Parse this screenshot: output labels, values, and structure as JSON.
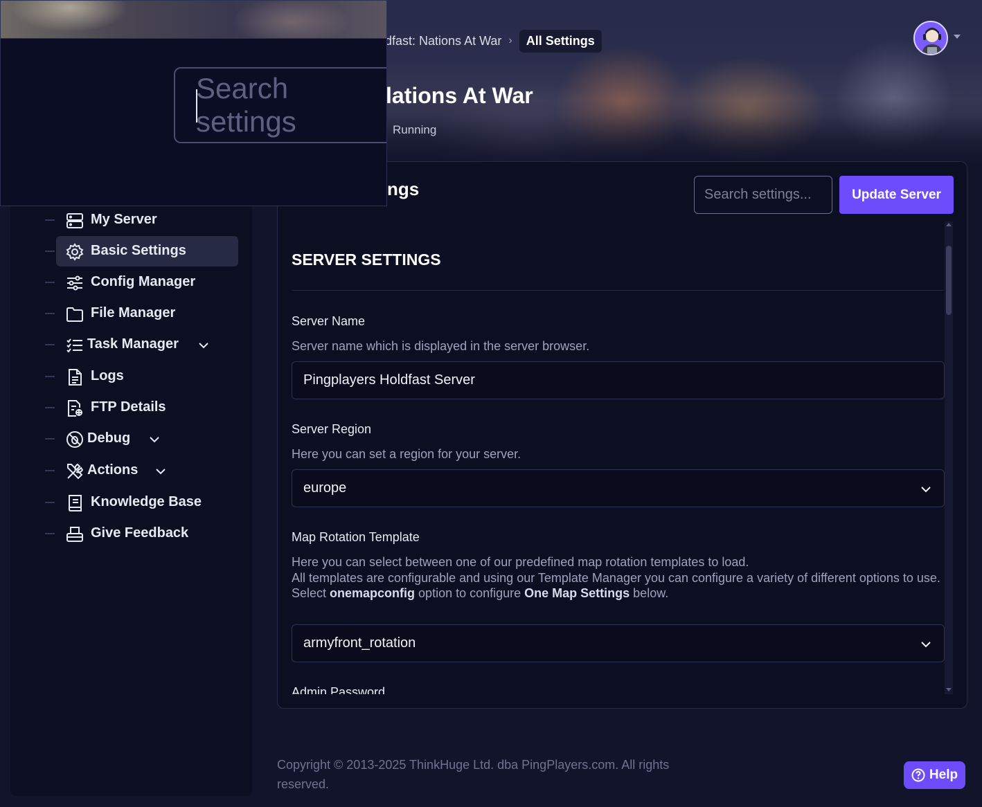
{
  "breadcrumb": {
    "game": "dfast: Nations At War",
    "current": "All Settings"
  },
  "header": {
    "title": "lations At War",
    "status": "Running"
  },
  "sidebar": {
    "items": [
      {
        "label": "My Server",
        "icon": "server-icon"
      },
      {
        "label": "Basic Settings",
        "icon": "gear-icon",
        "active": true
      },
      {
        "label": "Config Manager",
        "icon": "sliders-icon"
      },
      {
        "label": "File Manager",
        "icon": "folder-icon"
      },
      {
        "label": "Task Manager",
        "icon": "task-list-icon",
        "expandable": true
      },
      {
        "label": "Logs",
        "icon": "document-icon"
      },
      {
        "label": "FTP Details",
        "icon": "ftp-file-icon"
      },
      {
        "label": "Debug",
        "icon": "bug-icon",
        "expandable": true
      },
      {
        "label": "Actions",
        "icon": "tools-icon",
        "expandable": true
      },
      {
        "label": "Knowledge Base",
        "icon": "book-icon"
      },
      {
        "label": "Give Feedback",
        "icon": "feedback-icon"
      }
    ]
  },
  "card": {
    "title": "ngs",
    "search_placeholder": "Search settings...",
    "update_button": "Update Server"
  },
  "settings": {
    "section_title": "SERVER SETTINGS",
    "server_name": {
      "label": "Server Name",
      "description": "Server name which is displayed in the server browser.",
      "value": "Pingplayers Holdfast Server"
    },
    "server_region": {
      "label": "Server Region",
      "description": "Here you can set a region for your server.",
      "value": "europe"
    },
    "map_rotation": {
      "label": "Map Rotation Template",
      "desc_line1": "Here you can select between one of our predefined map rotation templates to load.",
      "desc_line2": "All templates are configurable and using our Template Manager you can configure a variety of different options to use.",
      "desc_line3_pre": "Select ",
      "desc_line3_bold1": "onemapconfig",
      "desc_line3_mid": " option to configure ",
      "desc_line3_bold2": "One Map Settings",
      "desc_line3_post": " below.",
      "value": "armyfront_rotation"
    },
    "admin_password": {
      "label": "Admin Password"
    }
  },
  "footer": {
    "copyright": "Copyright © 2013-2025 ThinkHuge Ltd. dba PingPlayers.com. All rights reserved."
  },
  "help": {
    "label": "Help"
  },
  "overlay": {
    "search_placeholder": "Search settings"
  },
  "colors": {
    "accent": "#6d4dfb",
    "background": "#12142b",
    "panel": "#0c0e22"
  }
}
